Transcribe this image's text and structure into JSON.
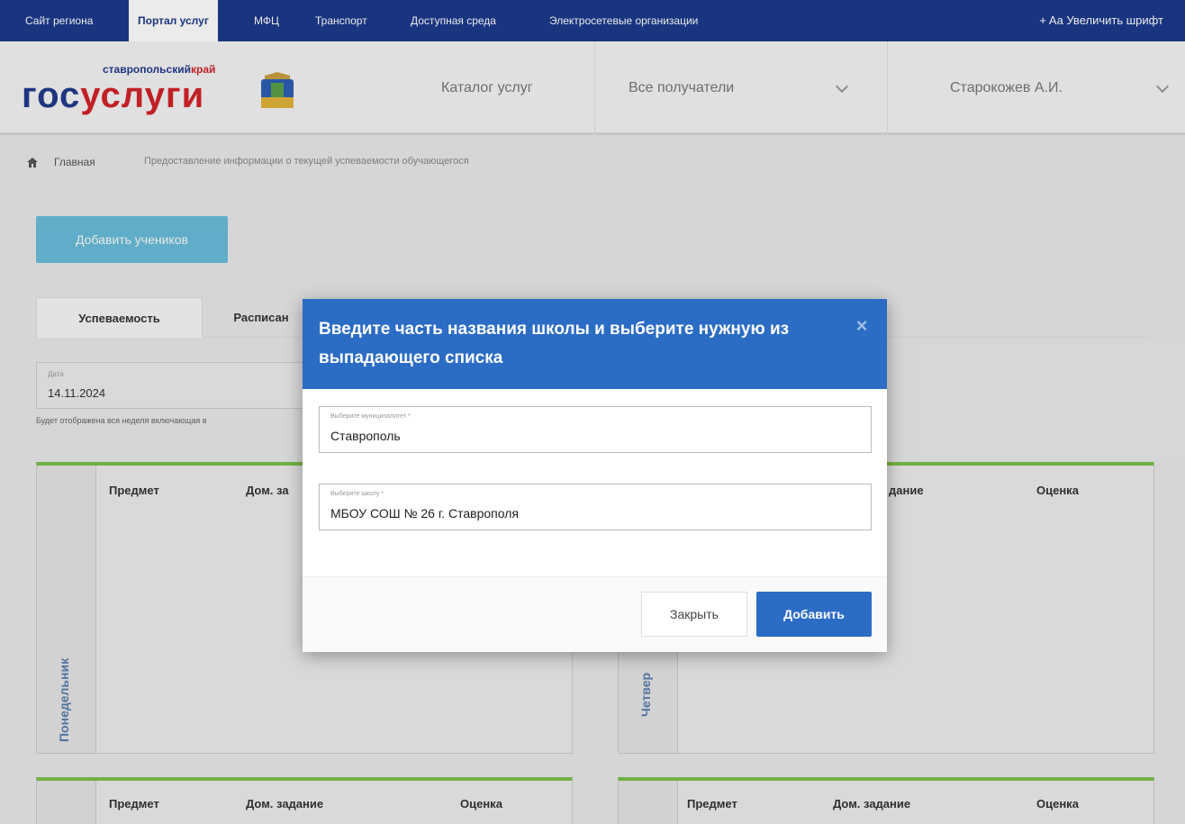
{
  "topnav": {
    "items": [
      "Сайт региона",
      "Портал услуг",
      "МФЦ",
      "Транспорт",
      "Доступная среда",
      "Электросетевые организации"
    ],
    "active_index": 1,
    "font_button": "+ Aa Увеличить шрифт"
  },
  "header": {
    "logo_small_prefix": "ставропольский",
    "logo_small_suffix": "край",
    "logo_part1": "гос",
    "logo_part2": "услуги",
    "catalog": "Каталог услуг",
    "recipients": "Все получатели",
    "user": "Старокожев А.И."
  },
  "breadcrumb": {
    "home": "Главная",
    "current": "Предоставление информации о текущей успеваемости обучающегося"
  },
  "main": {
    "add_students": "Добавить учеников",
    "tabs": [
      "Успеваемость",
      "Расписан"
    ],
    "date_label": "Дата",
    "date_value": "14.11.2024",
    "date_note": "Будет отображена вся неделя включающая в",
    "cards": {
      "monday": {
        "day": "Понедельник",
        "col1": "Предмет",
        "col2": "Дом. за"
      },
      "thursday": {
        "day": "Четвер",
        "col2": "дание",
        "col3": "Оценка"
      },
      "bottom_left": {
        "col1": "Предмет",
        "col2": "Дом. задание",
        "col3": "Оценка"
      },
      "bottom_right": {
        "col1": "Предмет",
        "col2": "Дом. задание",
        "col3": "Оценка"
      }
    }
  },
  "modal": {
    "title": "Введите часть названия школы и выберите нужную из выпадающего списка",
    "close_icon": "×",
    "municipality_label": "Выберите муниципалитет *",
    "municipality_value": "Ставрополь",
    "school_label": "Выберите школу *",
    "school_value": "МБОУ СОШ № 26 г. Ставрополя",
    "close_button": "Закрыть",
    "add_button": "Добавить"
  },
  "colors": {
    "nav": "#1d3a8a",
    "accent": "#2b6cc4",
    "green": "#7cc04b",
    "logo_red": "#d2232a"
  }
}
